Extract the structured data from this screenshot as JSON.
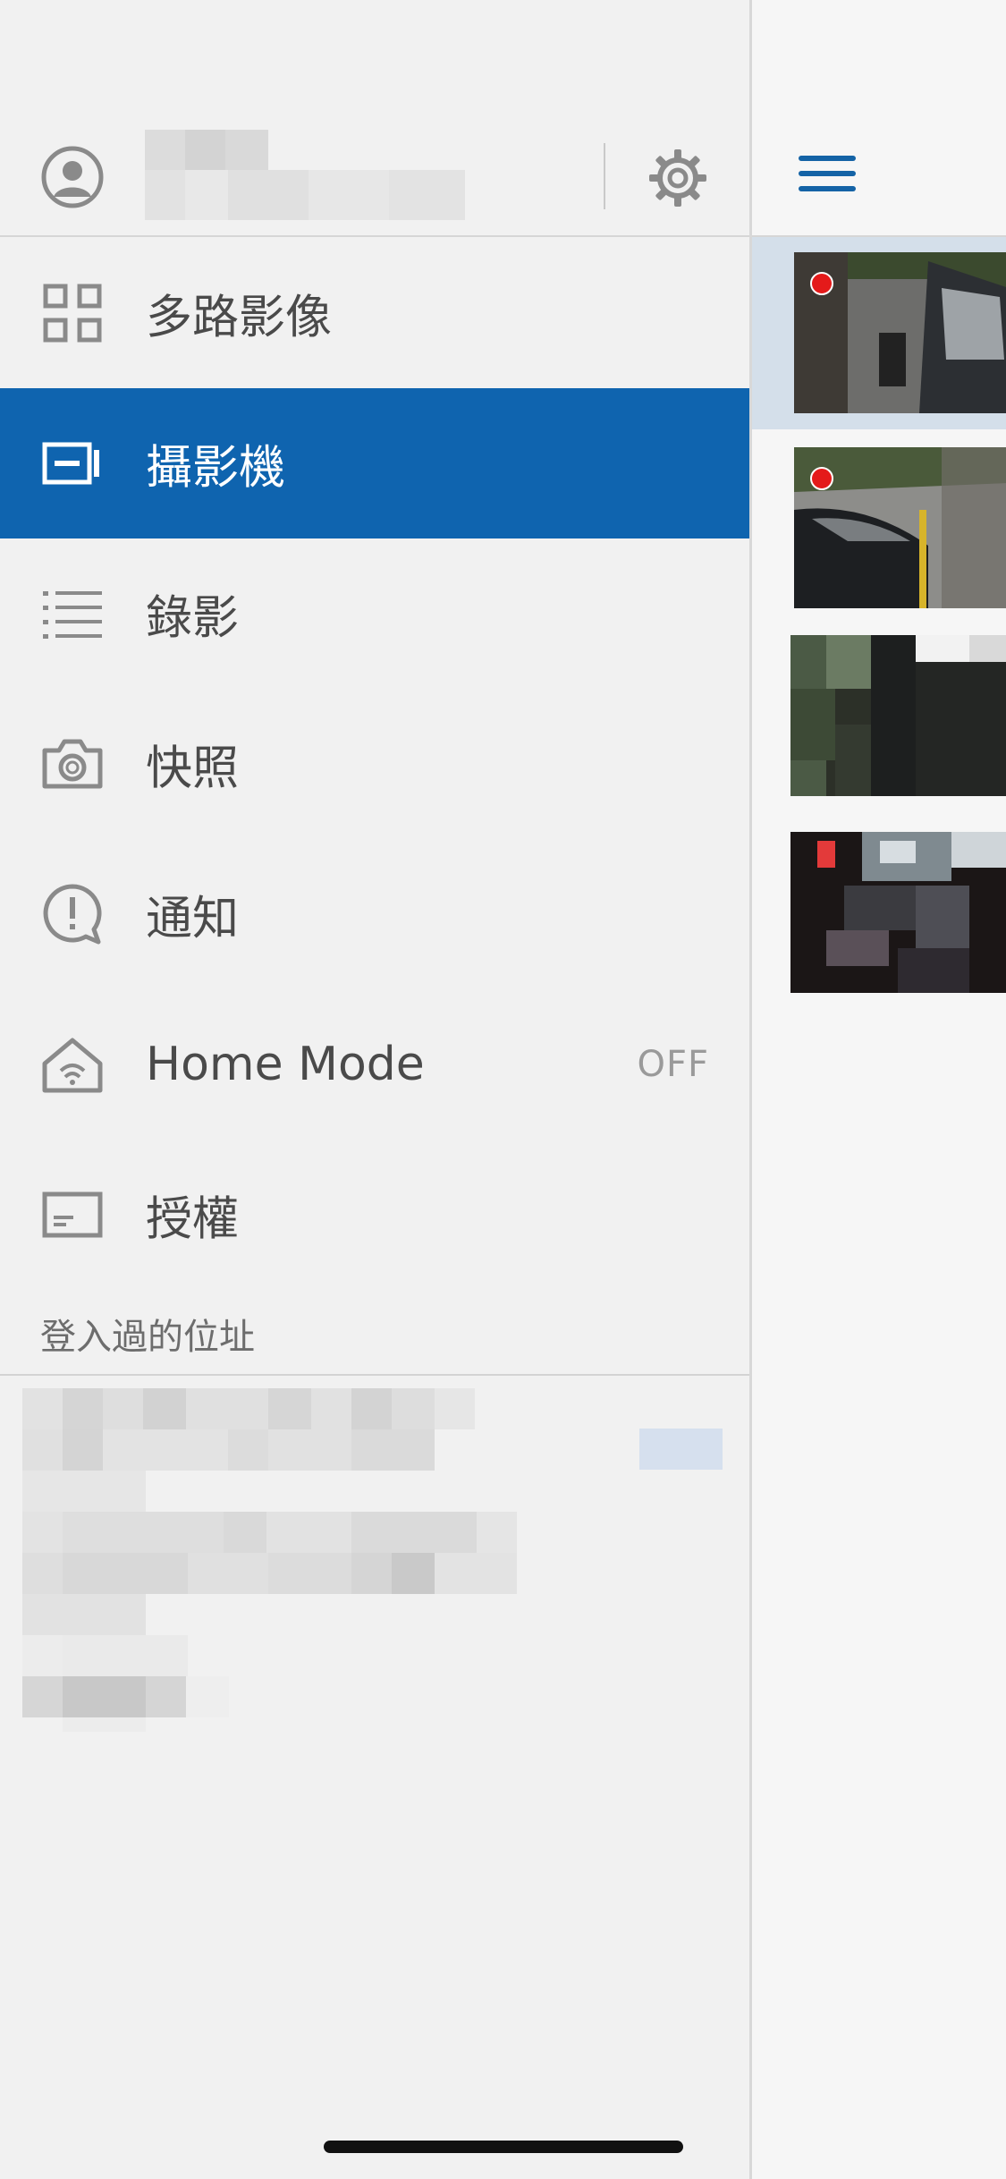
{
  "drawer": {
    "menu": [
      {
        "label": "多路影像",
        "icon": "grid-icon"
      },
      {
        "label": "攝影機",
        "icon": "camera-icon",
        "active": true
      },
      {
        "label": "錄影",
        "icon": "list-icon"
      },
      {
        "label": "快照",
        "icon": "snapshot-icon"
      },
      {
        "label": "通知",
        "icon": "notification-icon"
      },
      {
        "label": "Home Mode",
        "icon": "home-mode-icon",
        "value": "OFF"
      },
      {
        "label": "授權",
        "icon": "license-icon"
      }
    ],
    "section_title": "登入過的位址"
  },
  "colors": {
    "accent": "#0f64af",
    "hamburger": "#1463a6",
    "record": "#e41a1a"
  },
  "cameras": [
    {
      "recording": true
    },
    {
      "recording": true
    },
    {
      "recording": false
    },
    {
      "recording": false
    }
  ]
}
